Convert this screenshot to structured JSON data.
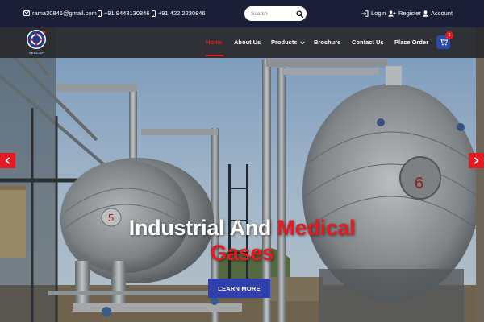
{
  "topbar": {
    "email": "rama30846@gmail.com",
    "phone1": "+91 9443130846",
    "phone2": "+91 422 2230846",
    "search_placeholder": "Search",
    "login": "Login",
    "register": "Register",
    "account": "Account"
  },
  "brand": {
    "logo_text": "VENCAP"
  },
  "nav": {
    "items": [
      {
        "label": "Home"
      },
      {
        "label": "About Us"
      },
      {
        "label": "Products"
      },
      {
        "label": "Brochure"
      },
      {
        "label": "Contact Us"
      },
      {
        "label": "Place Order"
      }
    ],
    "cart_count": "1"
  },
  "hero": {
    "title_part1": "Industrial And",
    "title_part2": "Medical",
    "title_part3": "Gases",
    "cta": "LEARN MORE"
  },
  "colors": {
    "accent_red": "#e31b23",
    "brand_blue": "#2f3fae",
    "topbar_bg": "#1a1e37"
  }
}
